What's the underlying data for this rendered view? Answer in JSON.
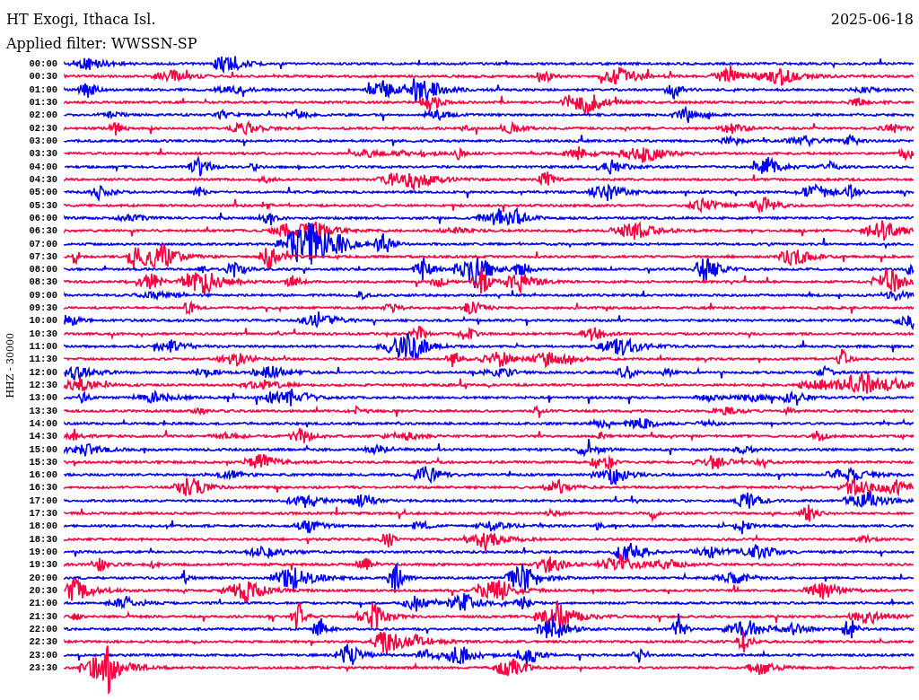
{
  "header": {
    "station": "HT Exogi, Ithaca Isl.",
    "date": "2025-06-18",
    "filter": "Applied filter: WWSSN-SP"
  },
  "axis_label": "HHZ - 30000",
  "rows": [
    {
      "time": "00:00",
      "color": "#0000ff"
    },
    {
      "time": "00:30",
      "color": "#ff0040"
    },
    {
      "time": "01:00",
      "color": "#0000ff"
    },
    {
      "time": "01:30",
      "color": "#ff0040"
    },
    {
      "time": "02:00",
      "color": "#0000ff"
    },
    {
      "time": "02:30",
      "color": "#ff0040"
    },
    {
      "time": "03:00",
      "color": "#0000ff"
    },
    {
      "time": "03:30",
      "color": "#ff0040"
    },
    {
      "time": "04:00",
      "color": "#0000ff"
    },
    {
      "time": "04:30",
      "color": "#ff0040"
    },
    {
      "time": "05:00",
      "color": "#0000ff"
    },
    {
      "time": "05:30",
      "color": "#ff0040"
    },
    {
      "time": "06:00",
      "color": "#0000ff"
    },
    {
      "time": "06:30",
      "color": "#ff0040"
    },
    {
      "time": "07:00",
      "color": "#0000ff"
    },
    {
      "time": "07:30",
      "color": "#ff0040"
    },
    {
      "time": "08:00",
      "color": "#0000ff"
    },
    {
      "time": "08:30",
      "color": "#ff0040"
    },
    {
      "time": "09:00",
      "color": "#0000ff"
    },
    {
      "time": "09:30",
      "color": "#ff0040"
    },
    {
      "time": "10:00",
      "color": "#0000ff"
    },
    {
      "time": "10:30",
      "color": "#ff0040"
    },
    {
      "time": "11:00",
      "color": "#0000ff"
    },
    {
      "time": "11:30",
      "color": "#ff0040"
    },
    {
      "time": "12:00",
      "color": "#0000ff"
    },
    {
      "time": "12:30",
      "color": "#ff0040"
    },
    {
      "time": "13:00",
      "color": "#0000ff"
    },
    {
      "time": "13:30",
      "color": "#ff0040"
    },
    {
      "time": "14:00",
      "color": "#0000ff"
    },
    {
      "time": "14:30",
      "color": "#ff0040"
    },
    {
      "time": "15:00",
      "color": "#0000ff"
    },
    {
      "time": "15:30",
      "color": "#ff0040"
    },
    {
      "time": "16:00",
      "color": "#0000ff"
    },
    {
      "time": "16:30",
      "color": "#ff0040"
    },
    {
      "time": "17:00",
      "color": "#0000ff"
    },
    {
      "time": "17:30",
      "color": "#ff0040"
    },
    {
      "time": "18:00",
      "color": "#0000ff"
    },
    {
      "time": "18:30",
      "color": "#ff0040"
    },
    {
      "time": "19:00",
      "color": "#0000ff"
    },
    {
      "time": "19:30",
      "color": "#ff0040"
    },
    {
      "time": "20:00",
      "color": "#0000ff"
    },
    {
      "time": "20:30",
      "color": "#ff0040"
    },
    {
      "time": "21:00",
      "color": "#0000ff"
    },
    {
      "time": "21:30",
      "color": "#ff0040"
    },
    {
      "time": "22:00",
      "color": "#0000ff"
    },
    {
      "time": "22:30",
      "color": "#ff0040"
    },
    {
      "time": "23:00",
      "color": "#0000ff"
    },
    {
      "time": "23:30",
      "color": "#ff0040"
    }
  ]
}
